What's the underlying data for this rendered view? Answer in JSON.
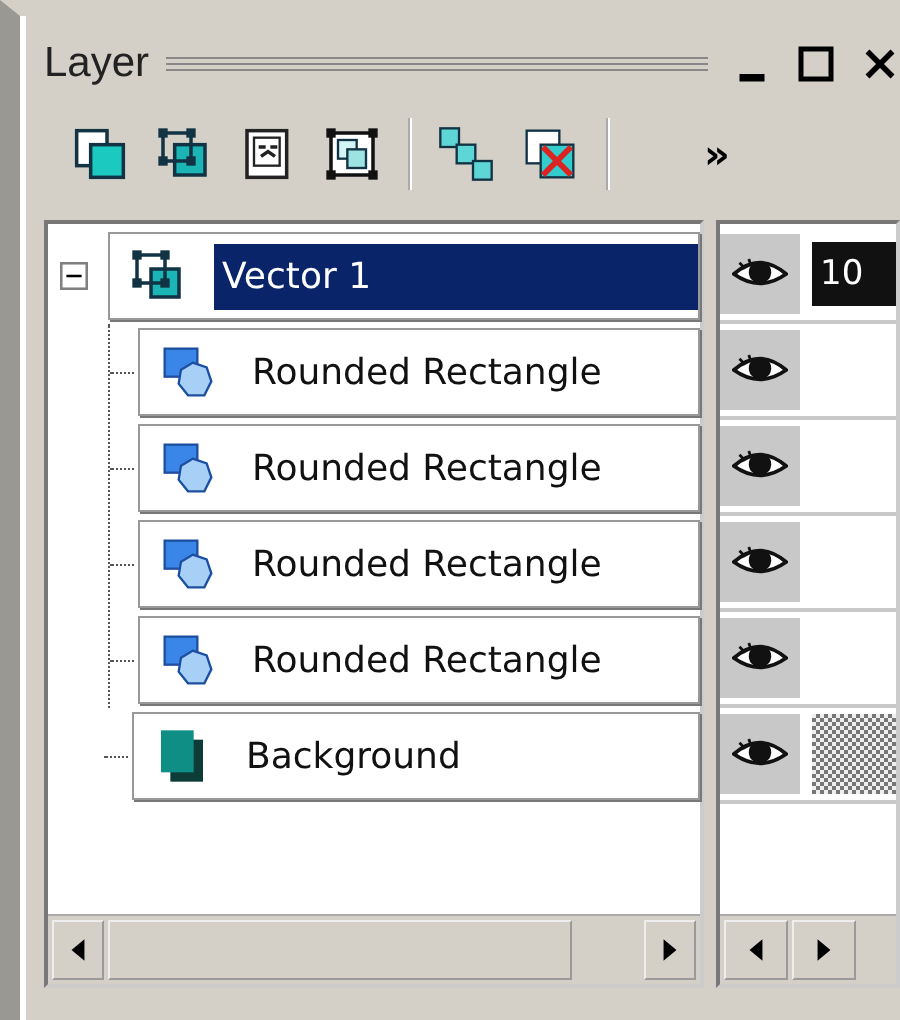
{
  "panel": {
    "title": "Layer"
  },
  "toolbar": {
    "overflow": "»"
  },
  "layers": [
    {
      "name": "Vector 1",
      "kind": "vector",
      "selected": true,
      "expanded": true,
      "visible": true,
      "opacity": "10",
      "children": [
        {
          "name": "Rounded Rectangle",
          "kind": "shape",
          "selected": false,
          "visible": true
        },
        {
          "name": "Rounded Rectangle",
          "kind": "shape",
          "selected": false,
          "visible": true
        },
        {
          "name": "Rounded Rectangle",
          "kind": "shape",
          "selected": false,
          "visible": true
        },
        {
          "name": "Rounded Rectangle",
          "kind": "shape",
          "selected": false,
          "visible": true
        }
      ]
    },
    {
      "name": "Background",
      "kind": "raster",
      "selected": false,
      "visible": true
    }
  ]
}
